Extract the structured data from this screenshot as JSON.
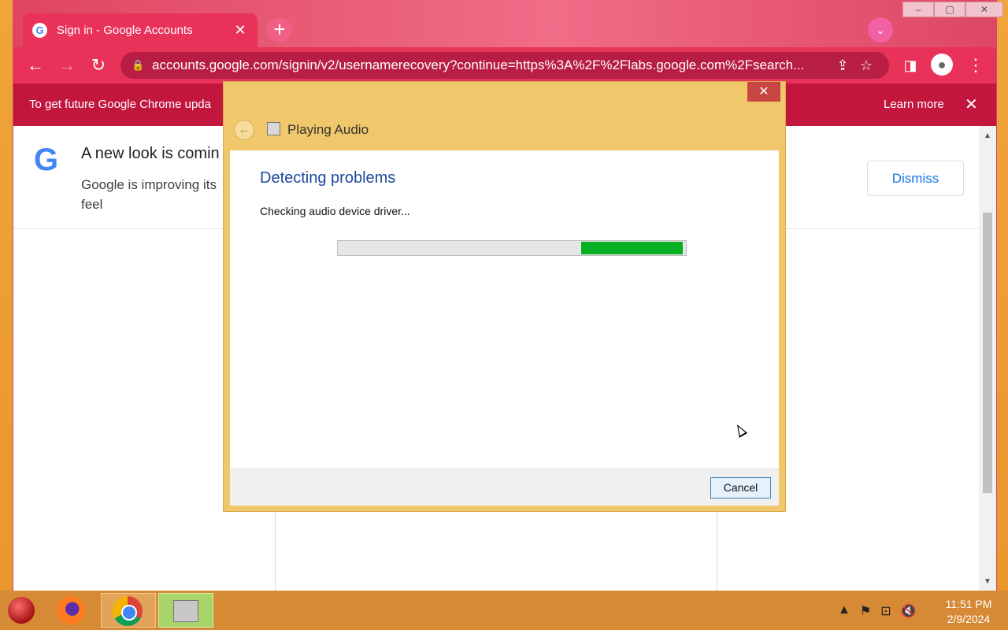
{
  "browser": {
    "tab": {
      "title": "Sign in - Google Accounts",
      "close": "✕"
    },
    "new_tab": "+",
    "profile_menu": "⌄",
    "window_controls": {
      "minimize": "‒",
      "maximize": "▢",
      "close": "✕"
    },
    "nav": {
      "back": "←",
      "forward": "→",
      "reload": "↻"
    },
    "url": "accounts.google.com/signin/v2/usernamerecovery?continue=https%3A%2F%2Flabs.google.com%2Fsearch...",
    "omnibox_icons": {
      "share": "⇪",
      "bookmark": "☆"
    },
    "infobar": {
      "message": "To get future Google Chrome upda",
      "learn_more": "Learn more",
      "close": "✕"
    }
  },
  "page": {
    "banner_title": "A new look is comin",
    "banner_body": "Google is improving its feel",
    "dismiss": "Dismiss",
    "scroll_up": "▲",
    "scroll_down": "▼"
  },
  "dialog": {
    "close": "✕",
    "back": "←",
    "title": "Playing Audio",
    "heading": "Detecting problems",
    "status": "Checking audio device driver...",
    "progress_fill_start_pct": 70,
    "progress_fill_end_pct": 99,
    "cancel": "Cancel"
  },
  "taskbar": {
    "time": "11:51 PM",
    "date": "2/9/2024",
    "tray": {
      "show_hidden": "▲",
      "flag": "⚑",
      "network": "⊡",
      "volume": "🔇"
    }
  },
  "colors": {
    "chrome_accent": "#e8325a",
    "dialog_frame": "#f0c76a",
    "progress_green": "#06b025"
  }
}
